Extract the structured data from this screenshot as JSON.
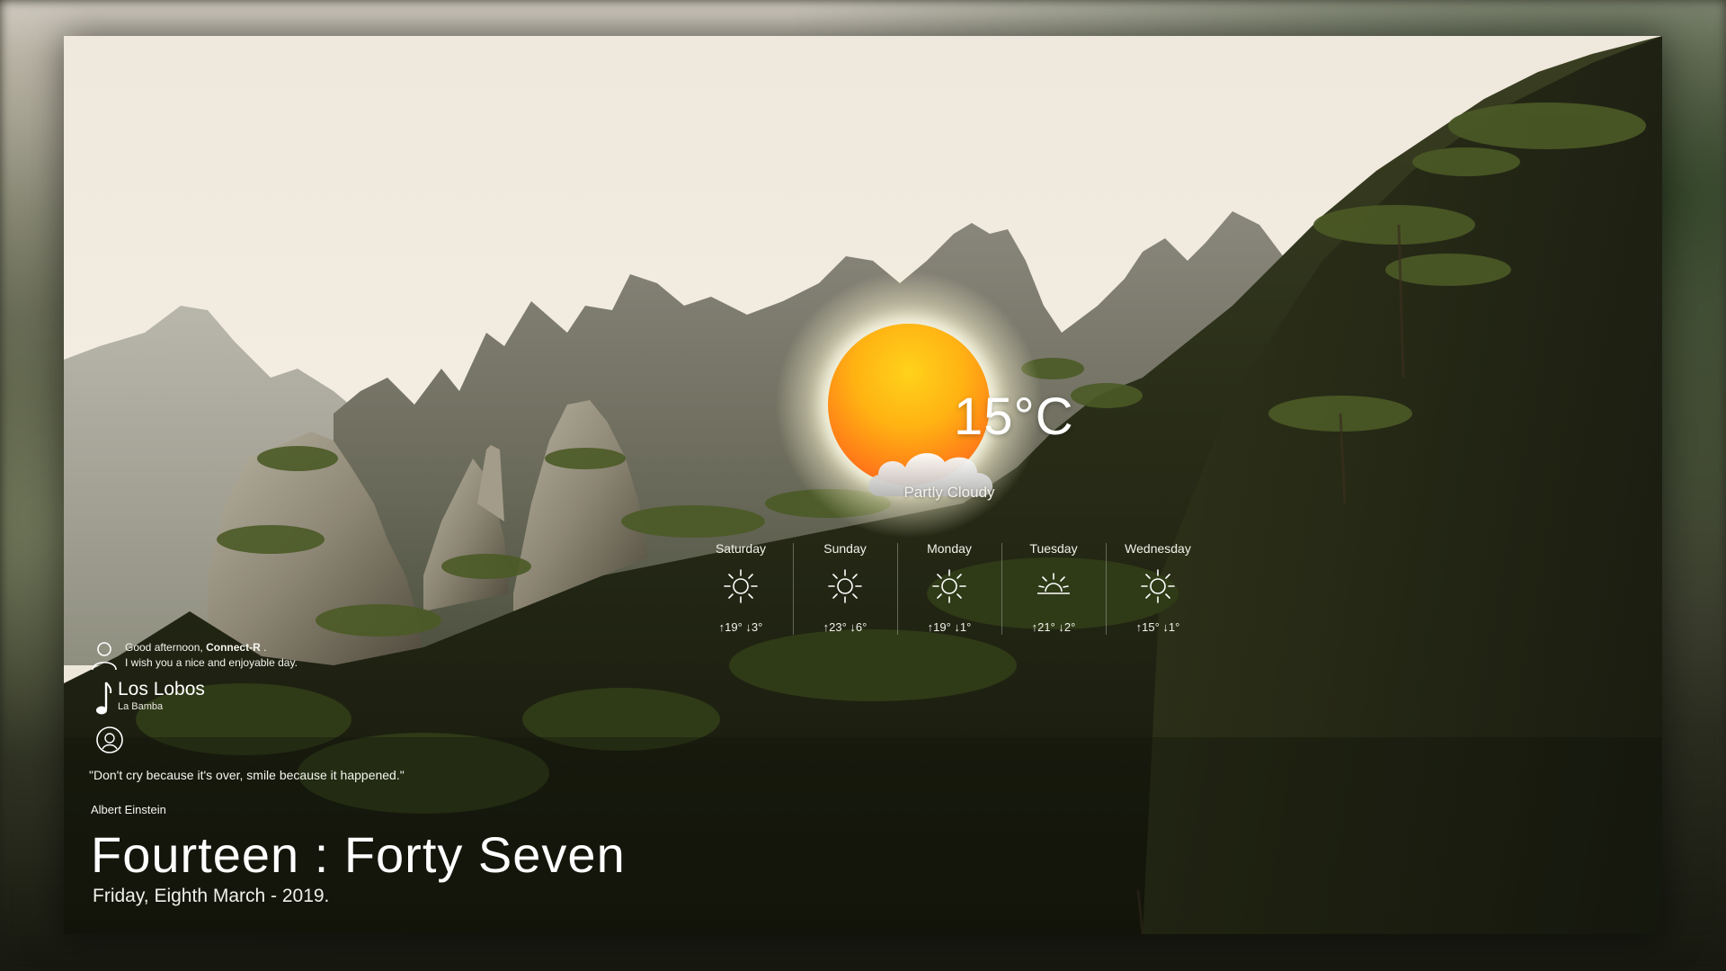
{
  "weather": {
    "temperature": "15°C",
    "condition": "Partly Cloudy",
    "current_icon": "sun-behind-cloud-icon",
    "forecast": [
      {
        "day": "Saturday",
        "temps": "↑19° ↓3°",
        "icon": "sun-icon"
      },
      {
        "day": "Sunday",
        "temps": "↑23° ↓6°",
        "icon": "sun-icon"
      },
      {
        "day": "Monday",
        "temps": "↑19° ↓1°",
        "icon": "sun-icon"
      },
      {
        "day": "Tuesday",
        "temps": "↑21° ↓2°",
        "icon": "sunrise-icon"
      },
      {
        "day": "Wednesday",
        "temps": "↑15° ↓1°",
        "icon": "sun-icon"
      }
    ]
  },
  "greeting": {
    "prefix": "Good afternoon,",
    "user": "Connect-R",
    "suffix": ".",
    "message": "I wish you a nice and enjoyable day."
  },
  "music": {
    "artist": "Los Lobos",
    "title": "La Bamba"
  },
  "quote": {
    "text": "\"Don't cry because it's over, smile because it happened.\"",
    "author": "Albert Einstein"
  },
  "clock": {
    "time": "Fourteen : Forty Seven",
    "date": "Friday, Eighth March - 2019."
  }
}
